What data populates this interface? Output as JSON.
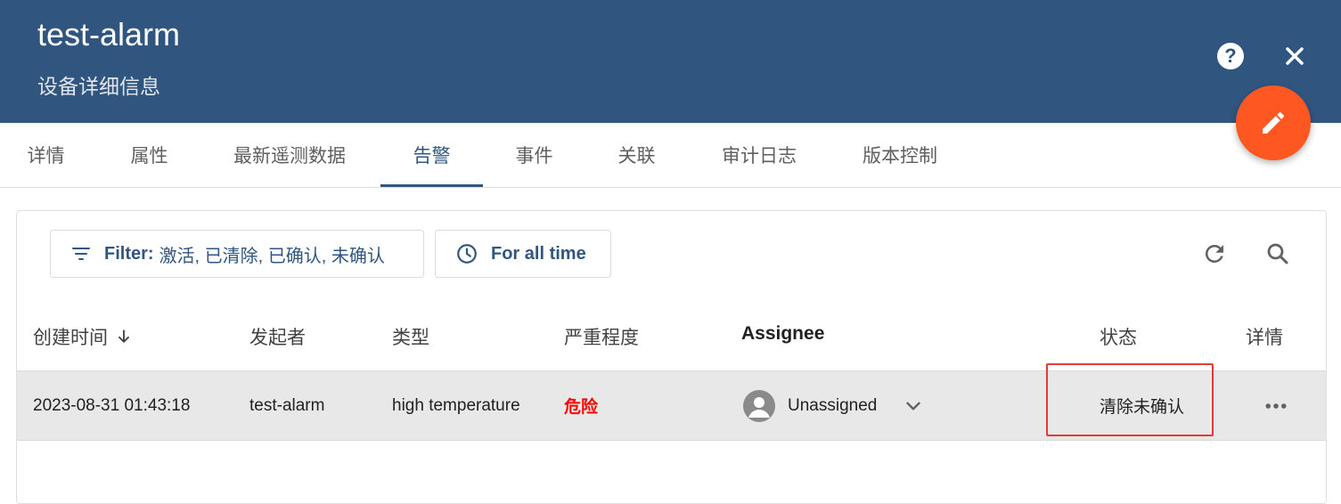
{
  "header": {
    "title": "test-alarm",
    "subtitle": "设备详细信息",
    "help_icon": "help-circle-icon",
    "close_icon": "close-icon",
    "bg_color": "#305680"
  },
  "fab": {
    "icon": "pencil-icon",
    "color": "#ff5722"
  },
  "tabs": [
    {
      "label": "详情"
    },
    {
      "label": "属性"
    },
    {
      "label": "最新遥测数据"
    },
    {
      "label": "告警",
      "active": true
    },
    {
      "label": "事件"
    },
    {
      "label": "关联"
    },
    {
      "label": "审计日志"
    },
    {
      "label": "版本控制"
    }
  ],
  "toolbar": {
    "filter_label": "Filter:",
    "filter_value": "激活, 已清除, 已确认, 未确认",
    "time_label": "For all time",
    "refresh_icon": "refresh-icon",
    "search_icon": "search-icon"
  },
  "table": {
    "headers": {
      "created_time": "创建时间",
      "originator": "发起者",
      "type": "类型",
      "severity": "严重程度",
      "assignee": "Assignee",
      "status": "状态",
      "details": "详情"
    },
    "rows": [
      {
        "created_time": "2023-08-31 01:43:18",
        "originator": "test-alarm",
        "type": "high temperature",
        "severity": "危险",
        "assignee": "Unassigned",
        "status": "清除未确认"
      }
    ]
  },
  "colors": {
    "primary": "#305680",
    "critical": "#ff0000",
    "accent": "#ff5722"
  }
}
